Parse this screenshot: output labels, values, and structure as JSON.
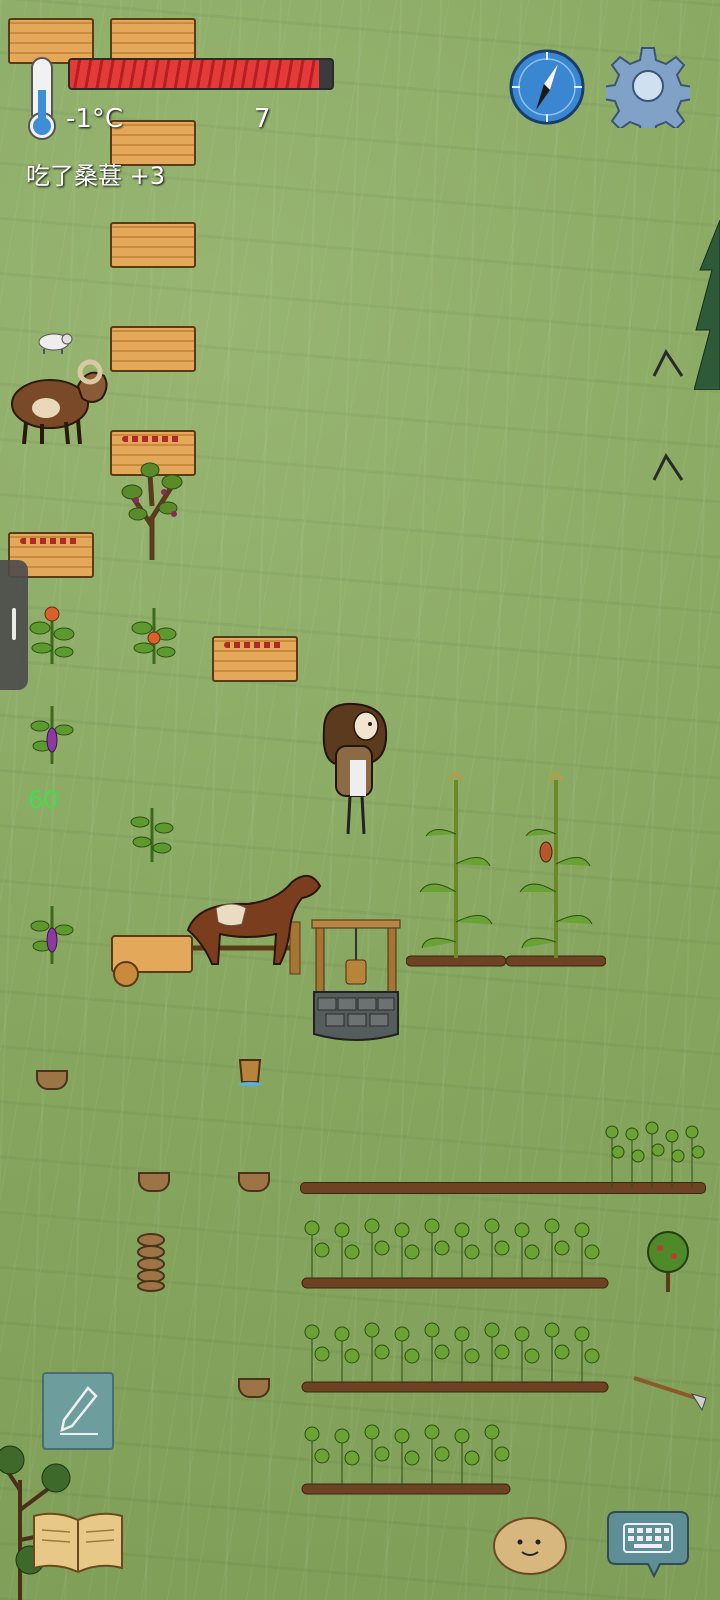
{
  "hud": {
    "temperature": "-1°C",
    "counter": "7",
    "status_message": "吃了桑葚 +3",
    "health_fraction": 0.95,
    "fps": "60"
  },
  "icons": {
    "thermometer": "thermometer-icon",
    "compass": "compass-icon",
    "settings": "gear-icon",
    "pencil": "pencil-icon",
    "book": "book-icon",
    "emote": "potato-face-icon",
    "keyboard": "keyboard-icon"
  },
  "colors": {
    "ground": "#86a65f",
    "health": "#e43a3a",
    "fps": "#3be04a",
    "wood": "#e3a85a"
  }
}
